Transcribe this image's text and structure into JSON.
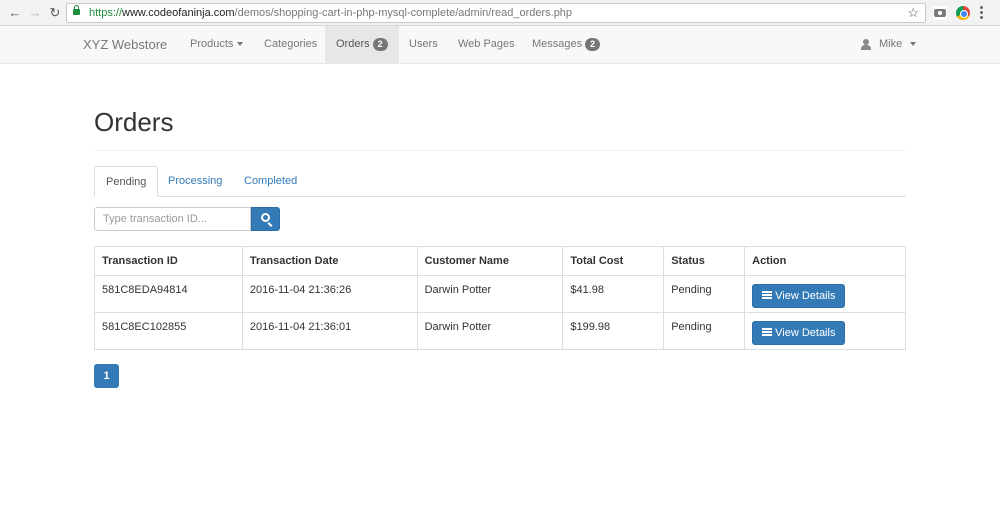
{
  "browser": {
    "url_scheme": "https://",
    "url_host": "www.codeofaninja.com",
    "url_path": "/demos/shopping-cart-in-php-mysql-complete/admin/read_orders.php",
    "icons": [
      "back-arrow-icon",
      "forward-arrow-icon",
      "reload-icon",
      "lock-icon",
      "star-icon",
      "camera-icon",
      "chrome-extension-icon",
      "menu-icon"
    ]
  },
  "navbar": {
    "brand": "XYZ Webstore",
    "items": [
      {
        "label": "Products",
        "dropdown": true
      },
      {
        "label": "Categories"
      },
      {
        "label": "Orders",
        "badge": "2",
        "active": true
      },
      {
        "label": "Users"
      },
      {
        "label": "Web Pages"
      },
      {
        "label": "Messages",
        "badge": "2"
      }
    ],
    "user": "Mike"
  },
  "page": {
    "title": "Orders",
    "tabs": [
      {
        "label": "Pending",
        "active": true
      },
      {
        "label": "Processing"
      },
      {
        "label": "Completed"
      }
    ],
    "search_placeholder": "Type transaction ID..."
  },
  "table": {
    "headers": [
      "Transaction ID",
      "Transaction Date",
      "Customer Name",
      "Total Cost",
      "Status",
      "Action"
    ],
    "rows": [
      {
        "transaction_id": "581C8EDA94814",
        "date": "2016-11-04 21:36:26",
        "customer": "Darwin Potter",
        "total": "$41.98",
        "status": "Pending",
        "action": "View Details"
      },
      {
        "transaction_id": "581C8EC102855",
        "date": "2016-11-04 21:36:01",
        "customer": "Darwin Potter",
        "total": "$199.98",
        "status": "Pending",
        "action": "View Details"
      }
    ]
  },
  "pagination": {
    "current_page": "1"
  },
  "colors": {
    "primary": "#337ab7",
    "badge": "#777777",
    "navbar_bg": "#f8f8f8",
    "secure_green": "#1e8c3a"
  }
}
